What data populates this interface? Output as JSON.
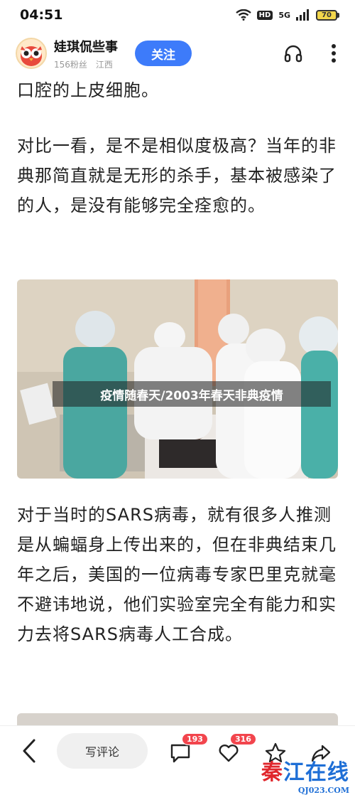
{
  "status_bar": {
    "time": "04:51",
    "hd": "HD",
    "signal": "5G",
    "battery": "70"
  },
  "header": {
    "author_name": "娃琪侃些事",
    "followers": "156粉丝",
    "location": "江西",
    "follow_label": "关注"
  },
  "article": {
    "p1": "口腔的上皮细胞。",
    "p2": "对比一看，是不是相似度极高？当年的非典那简直就是无形的杀手，基本被感染了的人，是没有能够完全痊愈的。",
    "image_caption": "疫情随春天/2003年春天非典疫情",
    "p3": "对于当时的SARS病毒，就有很多人推测是从蝙蝠身上传出来的，但在非典结束几年之后，美国的一位病毒专家巴里克就毫不避讳地说，他们实验室完全有能力和实力去将SARS病毒人工合成。"
  },
  "bottom_bar": {
    "comment_placeholder": "写评论",
    "comment_count": "193",
    "like_count": "316",
    "watermark_text_blue": "江在线",
    "watermark_text_red": "秦",
    "watermark_url": "QJ023.COM"
  },
  "colors": {
    "accent": "#3d7bfa",
    "badge": "#f2454d"
  }
}
